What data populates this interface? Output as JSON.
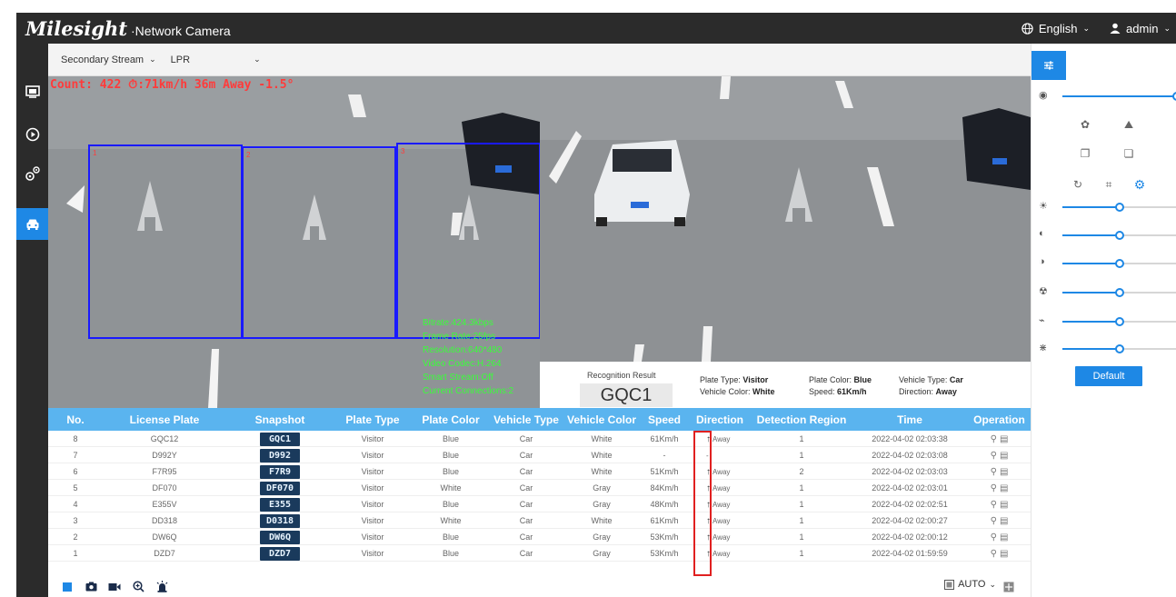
{
  "header": {
    "brand": "Milesight",
    "product": "·Network Camera",
    "language": "English",
    "user": "admin"
  },
  "nav": {
    "items": [
      {
        "name": "live-view-icon"
      },
      {
        "name": "playback-icon"
      },
      {
        "name": "settings-icon"
      },
      {
        "name": "vehicle-icon",
        "active": true
      }
    ]
  },
  "stream": {
    "stream_select": "Secondary Stream",
    "mode_select": "LPR"
  },
  "osd": {
    "text": "Count: 422  ⏱:71km/h 36m Away -1.5°",
    "info_lines": [
      "Bitrate:424.3kbps",
      "Frame Rate:25fps",
      "Resolution:640*480",
      "Video Codec:H.264",
      "Smart Stream:Off",
      "Current Connections:2"
    ],
    "regions": [
      "1",
      "2",
      "3"
    ]
  },
  "recognition": {
    "title": "Recognition Result",
    "plate": "GQC1",
    "plate_type_label": "Plate Type:",
    "plate_type": "Visitor",
    "plate_color_label": "Plate Color:",
    "plate_color": "Blue",
    "vehicle_type_label": "Vehicle Type:",
    "vehicle_type": "Car",
    "vehicle_color_label": "Vehicle Color:",
    "vehicle_color": "White",
    "speed_label": "Speed:",
    "speed": "61Km/h",
    "direction_label": "Direction:",
    "direction": "Away"
  },
  "table": {
    "headers": [
      "No.",
      "License Plate",
      "Snapshot",
      "Plate Type",
      "Plate Color",
      "Vehicle Type",
      "Vehicle Color",
      "Speed",
      "Direction",
      "Detection Region",
      "Time",
      "Operation"
    ],
    "rows": [
      {
        "no": "8",
        "plate": "GQC12",
        "snap": "GQC1",
        "type": "Visitor",
        "pcolor": "Blue",
        "vtype": "Car",
        "vcolor": "White",
        "speed": "61Km/h",
        "dir": "Away",
        "region": "1",
        "time": "2022-04-02 02:03:38"
      },
      {
        "no": "7",
        "plate": "D992Y",
        "snap": "D992",
        "type": "Visitor",
        "pcolor": "Blue",
        "vtype": "Car",
        "vcolor": "White",
        "speed": "-",
        "dir": "-",
        "region": "1",
        "time": "2022-04-02 02:03:08"
      },
      {
        "no": "6",
        "plate": "F7R95",
        "snap": "F7R9",
        "type": "Visitor",
        "pcolor": "Blue",
        "vtype": "Car",
        "vcolor": "White",
        "speed": "51Km/h",
        "dir": "Away",
        "region": "2",
        "time": "2022-04-02 02:03:03"
      },
      {
        "no": "5",
        "plate": "DF070",
        "snap": "DF070",
        "type": "Visitor",
        "pcolor": "White",
        "vtype": "Car",
        "vcolor": "Gray",
        "speed": "84Km/h",
        "dir": "Away",
        "region": "1",
        "time": "2022-04-02 02:03:01"
      },
      {
        "no": "4",
        "plate": "E355V",
        "snap": "E355",
        "type": "Visitor",
        "pcolor": "Blue",
        "vtype": "Car",
        "vcolor": "Gray",
        "speed": "48Km/h",
        "dir": "Away",
        "region": "1",
        "time": "2022-04-02 02:02:51"
      },
      {
        "no": "3",
        "plate": "DD318",
        "snap": "D0318",
        "type": "Visitor",
        "pcolor": "White",
        "vtype": "Car",
        "vcolor": "White",
        "speed": "61Km/h",
        "dir": "Away",
        "region": "1",
        "time": "2022-04-02 02:00:27"
      },
      {
        "no": "2",
        "plate": "DW6Q",
        "snap": "DW6Q",
        "type": "Visitor",
        "pcolor": "Blue",
        "vtype": "Car",
        "vcolor": "Gray",
        "speed": "53Km/h",
        "dir": "Away",
        "region": "1",
        "time": "2022-04-02 02:00:12"
      },
      {
        "no": "1",
        "plate": "DZD7",
        "snap": "DZD7",
        "type": "Visitor",
        "pcolor": "Blue",
        "vtype": "Car",
        "vcolor": "Gray",
        "speed": "53Km/h",
        "dir": "Away",
        "region": "1",
        "time": "2022-04-02 01:59:59"
      }
    ]
  },
  "bottom": {
    "auto_label": "AUTO"
  },
  "rightpanel": {
    "default_label": "Default",
    "sliders": [
      {
        "name": "zoom-slider",
        "icon": "zoom-icon",
        "value": 1.0
      },
      {
        "name": "brightness-slider",
        "icon": "brightness-icon",
        "value": 0.5
      },
      {
        "name": "contrast-slider",
        "icon": "contrast-icon",
        "value": 0.5
      },
      {
        "name": "saturation-slider",
        "icon": "saturation-icon",
        "value": 0.5
      },
      {
        "name": "sharpness-slider",
        "icon": "sharpness-icon",
        "value": 0.5
      },
      {
        "name": "noise-reduction-slider",
        "icon": "noise-reduction-icon",
        "value": 0.5
      },
      {
        "name": "wdr-slider",
        "icon": "wdr-icon",
        "value": 0.5
      }
    ]
  },
  "colors": {
    "accent": "#1e88e5",
    "header_bg": "#2b2b2b",
    "table_header": "#5ab4ef",
    "osd_red": "#ff3b3b",
    "osd_green": "#39ff39",
    "highlight": "#e02020"
  }
}
